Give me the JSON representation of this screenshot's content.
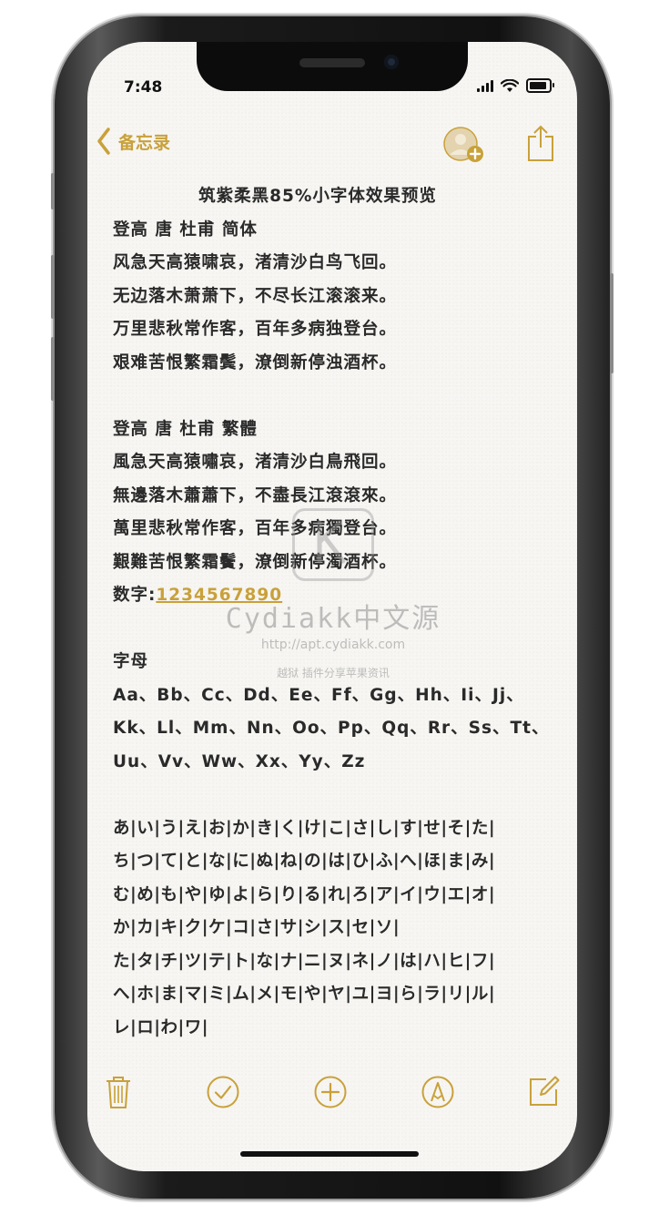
{
  "status_bar": {
    "time": "7:48"
  },
  "nav": {
    "back_label": "备忘录"
  },
  "note": {
    "title": "筑紫柔黑85%小字体效果预览",
    "section_simplified": {
      "heading": "登高 唐 杜甫 简体",
      "lines": [
        "风急天高猿啸哀，渚清沙白鸟飞回。",
        "无边落木萧萧下，不尽长江滚滚来。",
        "万里悲秋常作客，百年多病独登台。",
        "艰难苦恨繁霜鬓，潦倒新停浊酒杯。"
      ]
    },
    "section_traditional": {
      "heading": "登高 唐 杜甫 繁體",
      "lines": [
        "風急天高猿嘯哀，渚清沙白鳥飛回。",
        "無邊落木蕭蕭下，不盡長江滾滾來。",
        "萬里悲秋常作客，百年多病獨登台。",
        "艱難苦恨繁霜鬢，潦倒新停濁酒杯。"
      ]
    },
    "digits_label": "数字:",
    "digits_value": "1234567890",
    "letters": {
      "heading": "字母",
      "lines": [
        "Aa、Bb、Cc、Dd、Ee、Ff、Gg、Hh、Ii、Jj、",
        "Kk、Ll、Mm、Nn、Oo、Pp、Qq、Rr、Ss、Tt、",
        "Uu、Vv、Ww、Xx、Yy、Zz"
      ]
    },
    "kana": [
      "あ|い|う|え|お|か|き|く|け|こ|さ|し|す|せ|そ|た|",
      "ち|つ|て|と|な|に|ぬ|ね|の|は|ひ|ふ|へ|ほ|ま|み|",
      "む|め|も|や|ゆ|よ|ら|り|る|れ|ろ|ア|イ|ウ|エ|オ|",
      "か|カ|キ|ク|ケ|コ|さ|サ|シ|ス|セ|ソ|",
      "た|タ|チ|ツ|テ|ト|な|ナ|ニ|ヌ|ネ|ノ|は|ハ|ヒ|フ|",
      "へ|ホ|ま|マ|ミ|ム|メ|モ|や|ヤ|ユ|ヨ|ら|ラ|リ|ル|",
      "レ|ロ|わ|ワ|"
    ]
  },
  "watermark": {
    "name": "Cydiakk中文源",
    "url": "http://apt.cydiakk.com",
    "tagline": "越狱 插件分享苹果资讯"
  },
  "colors": {
    "accent": "#c9a13a",
    "text": "#2a2a2a",
    "paper": "#f7f6f3"
  }
}
